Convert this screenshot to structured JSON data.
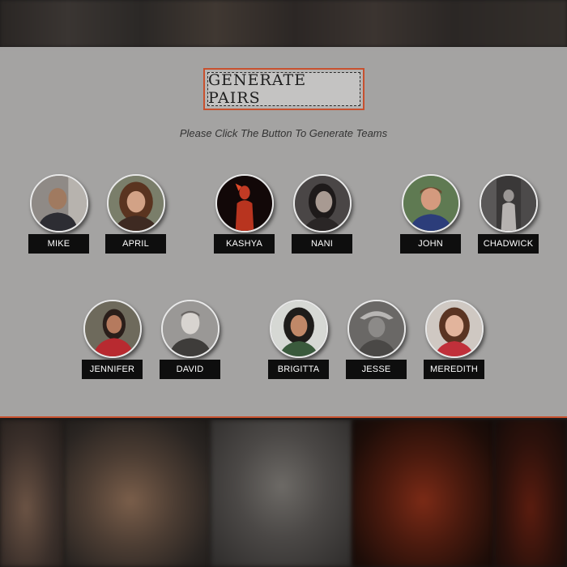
{
  "header": {
    "button_label": "GENERATE PAIRS",
    "instruction": "Please Click The Button To Generate Teams"
  },
  "colors": {
    "accent": "#c8502e",
    "panel": "#aeadac",
    "name_tag": "#0e0e0e"
  },
  "people": [
    {
      "name": "MIKE",
      "icon": "portrait-mike"
    },
    {
      "name": "APRIL",
      "icon": "portrait-april"
    },
    {
      "name": "KASHYA",
      "icon": "portrait-kashya"
    },
    {
      "name": "NANI",
      "icon": "portrait-nani"
    },
    {
      "name": "JOHN",
      "icon": "portrait-john"
    },
    {
      "name": "CHADWICK",
      "icon": "portrait-chadwick"
    },
    {
      "name": "JENNIFER",
      "icon": "portrait-jennifer"
    },
    {
      "name": "DAVID",
      "icon": "portrait-david"
    },
    {
      "name": "BRIGITTA",
      "icon": "portrait-brigitta"
    },
    {
      "name": "JESSE",
      "icon": "portrait-jesse"
    },
    {
      "name": "MEREDITH",
      "icon": "portrait-meredith"
    }
  ]
}
